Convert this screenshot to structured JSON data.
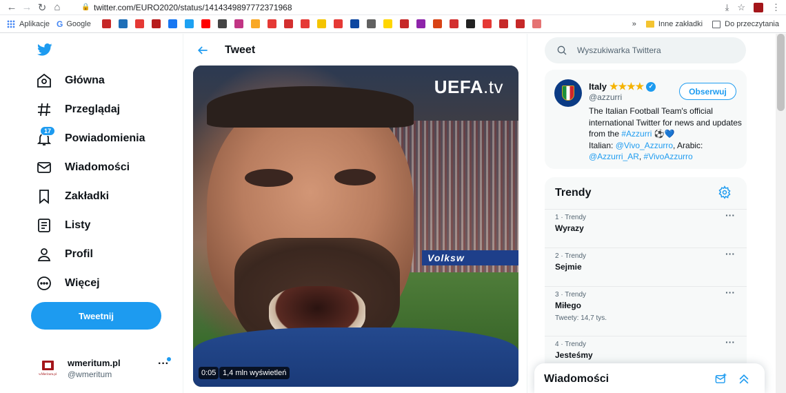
{
  "browser": {
    "url": "twitter.com/EURO2020/status/1414349897772371968",
    "bookmarks": [
      {
        "label": "Aplikacje"
      },
      {
        "label": "Google"
      }
    ],
    "bookmark_icons": [
      {
        "color": "#c62828"
      },
      {
        "color": "#1e6fb8"
      },
      {
        "color": "#e53935"
      },
      {
        "color": "#b71c1c"
      },
      {
        "color": "#1877f2"
      },
      {
        "color": "#1da1f2"
      },
      {
        "color": "#ff0000"
      },
      {
        "color": "#444444"
      },
      {
        "color": "#c13584"
      },
      {
        "color": "#f9a825"
      },
      {
        "color": "#e53935"
      },
      {
        "color": "#d32f2f"
      },
      {
        "color": "#e53935"
      },
      {
        "color": "#f4c400"
      },
      {
        "color": "#e53935"
      },
      {
        "color": "#0d47a1"
      },
      {
        "color": "#616161"
      },
      {
        "color": "#ffd600"
      },
      {
        "color": "#c62828"
      },
      {
        "color": "#8e24aa"
      },
      {
        "color": "#d84315"
      },
      {
        "color": "#d32f2f"
      },
      {
        "color": "#222222"
      },
      {
        "color": "#e53935"
      },
      {
        "color": "#c62828"
      },
      {
        "color": "#c62828"
      },
      {
        "color": "#e57373"
      }
    ],
    "overflow": "»",
    "other_bookmarks": "Inne zakładki",
    "reading_list": "Do przeczytania"
  },
  "sidebar": {
    "items": [
      {
        "label": "Główna"
      },
      {
        "label": "Przeglądaj"
      },
      {
        "label": "Powiadomienia",
        "badge": "17"
      },
      {
        "label": "Wiadomości"
      },
      {
        "label": "Zakładki"
      },
      {
        "label": "Listy"
      },
      {
        "label": "Profil"
      },
      {
        "label": "Więcej"
      }
    ],
    "tweet_button": "Tweetnij",
    "account": {
      "name": "wmeritum.pl",
      "handle": "@wmeritum",
      "logo_text": "wMeritum.pl",
      "more": "···"
    }
  },
  "main": {
    "title": "Tweet",
    "video": {
      "watermark": "UEFA",
      "watermark_suffix": ".tv",
      "time": "0:05",
      "views": "1,4 mln wyświetleń",
      "board_text": "Volksw"
    }
  },
  "right": {
    "search_placeholder": "Wyszukiwarka Twittera",
    "profile": {
      "name": "Italy",
      "stars": "★★★★",
      "handle": "@azzurri",
      "follow_label": "Obserwuj",
      "bio_1": "The Italian Football Team's official international Twitter for news and updates from the ",
      "bio_hashtag": "#Azzurri",
      "bio_emoji": " ⚽💙",
      "bio_2": "Italian: ",
      "bio_link1": "@Vivo_Azzurro",
      "bio_3": ", Arabic: ",
      "bio_link2": "@Azzurri_AR",
      "bio_4": ", ",
      "bio_link3": "#VivoAzzurro"
    },
    "trends": {
      "title": "Trendy",
      "items": [
        {
          "meta": "1 · Trendy",
          "name": "Wyrazy",
          "count": ""
        },
        {
          "meta": "2 · Trendy",
          "name": "Sejmie",
          "count": ""
        },
        {
          "meta": "3 · Trendy",
          "name": "Miłego",
          "count": "Tweety: 14,7 tys."
        },
        {
          "meta": "4 · Trendy",
          "name": "Jesteśmy",
          "count": ""
        }
      ],
      "dots": "···"
    },
    "messages": {
      "title": "Wiadomości"
    }
  }
}
